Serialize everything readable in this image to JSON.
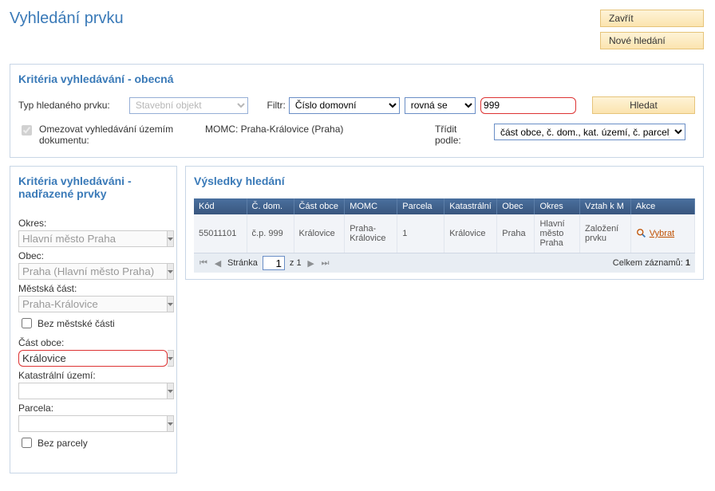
{
  "header": {
    "title": "Vyhledání prvku"
  },
  "buttons": {
    "close": "Zavřít",
    "new_search": "Nové hledání",
    "search": "Hledat"
  },
  "criteria_general": {
    "title": "Kritéria vyhledávání - obecná",
    "type_label": "Typ hledaného prvku:",
    "type_value": "Stavební objekt",
    "filter_label": "Filtr:",
    "filter_field": "Číslo domovní",
    "filter_op": "rovná se",
    "filter_value": "999",
    "restrict_label": "Omezovat vyhledávání územím dokumentu:",
    "momc_label": "MOMC: Praha-Královice (Praha)",
    "sort_label": "Třídit podle:",
    "sort_value": "část obce, č. dom., kat. území, č. parcely"
  },
  "criteria_parent": {
    "title": "Kritéria vyhledáváni - nadřazené prvky",
    "okres_label": "Okres:",
    "okres_value": "Hlavní město Praha",
    "obec_label": "Obec:",
    "obec_value": "Praha (Hlavní město Praha)",
    "mc_label": "Městská část:",
    "mc_value": "Praha-Královice",
    "bez_mc": "Bez městské části",
    "cast_label": "Část obce:",
    "cast_value": "Královice",
    "ku_label": "Katastrální území:",
    "ku_value": "",
    "parcela_label": "Parcela:",
    "parcela_value": "",
    "bez_parcely": "Bez parcely"
  },
  "results": {
    "title": "Výsledky hledání",
    "columns": [
      "Kód",
      "Č. dom.",
      "Část obce",
      "MOMC",
      "Parcela",
      "Katastrální",
      "Obec",
      "Okres",
      "Vztah k M",
      "Akce"
    ],
    "rows": [
      {
        "kod": "55011101",
        "cdom": "č.p. 999",
        "cast": "Královice",
        "momc": "Praha-Královice",
        "parcela": "1",
        "ku": "Královice",
        "obec": "Praha",
        "okres": "Hlavní město Praha",
        "vztah": "Založení prvku",
        "akce": "Vybrat"
      }
    ],
    "pager": {
      "page_label": "Stránka",
      "page": "1",
      "of_label": "z 1",
      "total_label": "Celkem záznamů:",
      "total": "1"
    }
  }
}
